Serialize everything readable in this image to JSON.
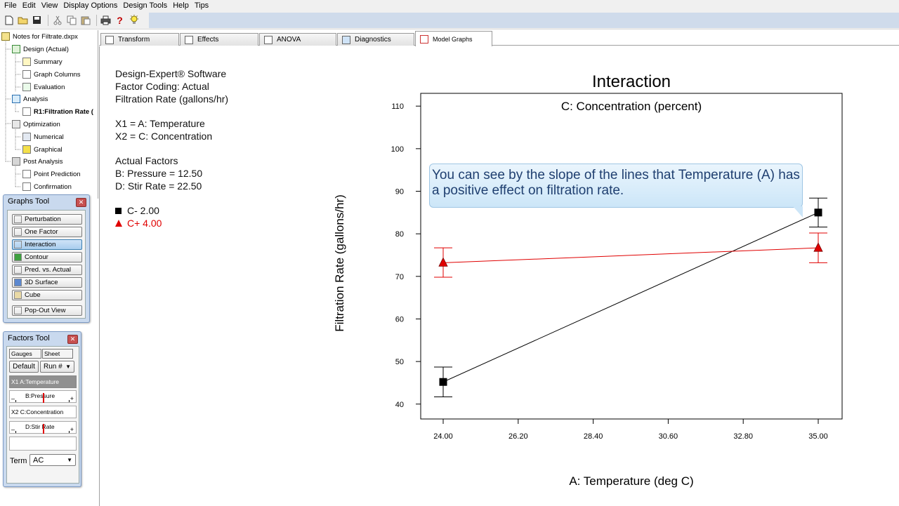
{
  "menu": [
    "File",
    "Edit",
    "View",
    "Display Options",
    "Design Tools",
    "Help",
    "Tips"
  ],
  "toolbar": {
    "icons": [
      "new-file-icon",
      "open-folder-icon",
      "save-icon",
      "cut-icon",
      "copy-icon",
      "paste-icon",
      "print-icon",
      "help-icon",
      "tips-bulb-icon"
    ]
  },
  "tree": {
    "root": "Notes for Filtrate.dxpx",
    "design": "Design (Actual)",
    "summary": "Summary",
    "graph_columns": "Graph Columns",
    "evaluation": "Evaluation",
    "analysis": "Analysis",
    "r1": "R1:Filtration Rate (",
    "optimization": "Optimization",
    "numerical": "Numerical",
    "graphical": "Graphical",
    "post_analysis": "Post Analysis",
    "point_prediction": "Point Prediction",
    "confirmation": "Confirmation"
  },
  "graphs_tool": {
    "title": "Graphs Tool",
    "buttons": [
      "Perturbation",
      "One Factor",
      "Interaction",
      "Contour",
      "Pred. vs. Actual",
      "3D Surface",
      "Cube"
    ],
    "popout": "Pop-Out View",
    "active_index": 2
  },
  "factors_tool": {
    "title": "Factors Tool",
    "tab_gauges": "Gauges",
    "tab_sheet": "Sheet",
    "default_btn": "Default",
    "run_select": "Run #",
    "x1_row": "X1 A:Temperature",
    "b_slider": "B:Pressure",
    "x2_row": "X2 C:Concentration",
    "d_slider": "D:Stir Rate",
    "minus": "–",
    "plus": "+",
    "term_label": "Term",
    "term_value": "AC"
  },
  "tabs": [
    "Transform",
    "Effects",
    "ANOVA",
    "Diagnostics",
    "Model Graphs"
  ],
  "active_tab": 4,
  "info": {
    "line1": "Design-Expert® Software",
    "line2": "Factor Coding: Actual",
    "line3": "Filtration Rate (gallons/hr)",
    "line4": "X1 = A: Temperature",
    "line5": "X2 = C: Concentration",
    "line6": "Actual Factors",
    "line7": "B: Pressure = 12.50",
    "line8": "D: Stir Rate = 22.50",
    "legend_low": "C- 2.00",
    "legend_high": "C+ 4.00"
  },
  "callout": {
    "text": "You can see by the slope of the lines that Temperature (A) has a positive effect on filtration rate."
  },
  "colors": {
    "series_low": "#000000",
    "series_high": "#e00000",
    "callout_text": "#1f3f70"
  },
  "chart_data": {
    "type": "line",
    "title": "Interaction",
    "subtitle": "C: Concentration (percent)",
    "xlabel": "A: Temperature (deg C)",
    "ylabel": "Filtration Rate (gallons/hr)",
    "xlim": [
      24.0,
      35.0
    ],
    "ylim": [
      36.5,
      113
    ],
    "xticks": [
      "24.00",
      "26.20",
      "28.40",
      "30.60",
      "32.80",
      "35.00"
    ],
    "yticks": [
      40,
      50,
      60,
      70,
      80,
      90,
      100,
      110
    ],
    "x": [
      24.0,
      35.0
    ],
    "series": [
      {
        "name": "C- 2.00",
        "values": [
          45.2,
          85.0
        ],
        "lower": [
          41.7,
          81.6
        ],
        "upper": [
          48.7,
          88.4
        ],
        "marker": "square"
      },
      {
        "name": "C+ 4.00",
        "values": [
          73.2,
          76.7
        ],
        "lower": [
          69.8,
          73.2
        ],
        "upper": [
          76.7,
          80.2
        ],
        "marker": "triangle"
      }
    ]
  }
}
